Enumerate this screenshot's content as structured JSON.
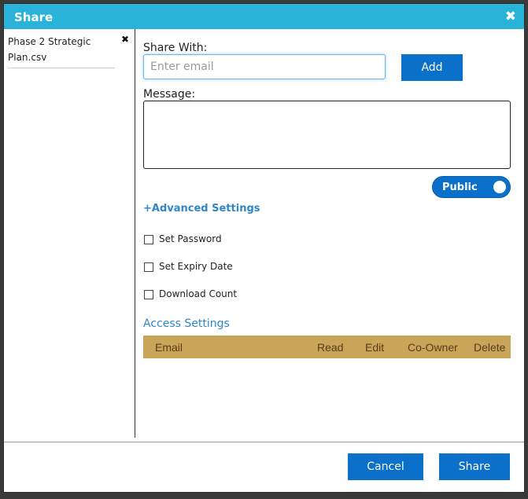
{
  "dialog": {
    "title": "Share",
    "close_icon": "close-icon"
  },
  "files": [
    {
      "name": "Phase 2 Strategic Plan.csv",
      "remove_icon": "remove-icon"
    }
  ],
  "share_with": {
    "label": "Share With:",
    "placeholder": "Enter email",
    "value": "",
    "add_label": "Add"
  },
  "message": {
    "label": "Message:",
    "value": ""
  },
  "visibility": {
    "label": "Public",
    "enabled": true
  },
  "advanced": {
    "toggle_symbol": "+",
    "label": "Advanced Settings",
    "options": [
      {
        "label": "Set Password",
        "checked": false
      },
      {
        "label": "Set Expiry Date",
        "checked": false
      },
      {
        "label": "Download Count",
        "checked": false
      }
    ]
  },
  "access": {
    "title": "Access Settings",
    "columns": [
      "Email",
      "Read",
      "Edit",
      "Co-Owner",
      "Delete"
    ],
    "header_color": "#c9a55a",
    "rows": []
  },
  "footer": {
    "cancel_label": "Cancel",
    "share_label": "Share"
  },
  "colors": {
    "titlebar": "#29b3d9",
    "primary_button": "#0a70c9",
    "link": "#2f86c8"
  }
}
